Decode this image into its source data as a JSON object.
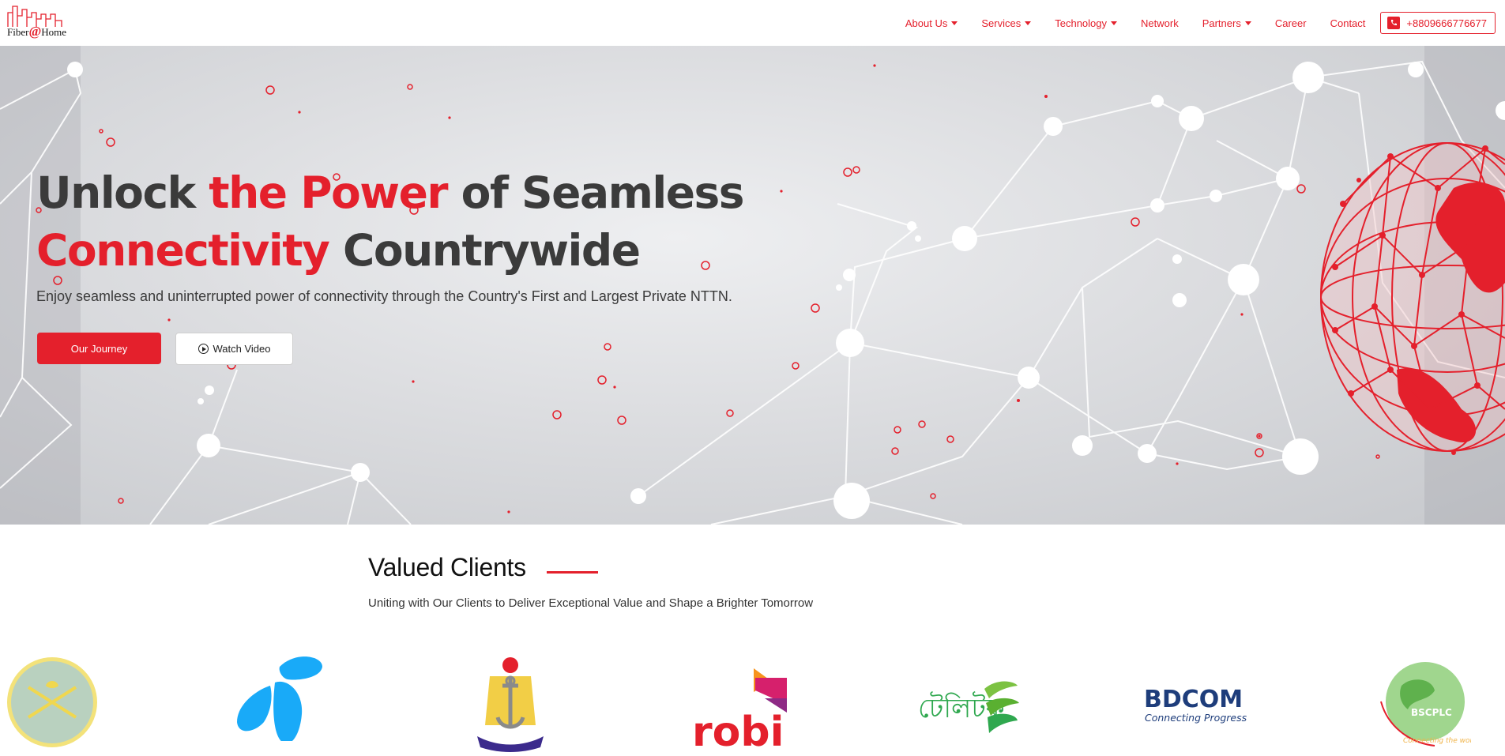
{
  "header": {
    "logo_text_1": "Fiber",
    "logo_at": "@",
    "logo_text_2": "Home",
    "nav": [
      {
        "label": "About Us",
        "dropdown": true
      },
      {
        "label": "Services",
        "dropdown": true
      },
      {
        "label": "Technology",
        "dropdown": true
      },
      {
        "label": "Network",
        "dropdown": false
      },
      {
        "label": "Partners",
        "dropdown": true
      },
      {
        "label": "Career",
        "dropdown": false
      },
      {
        "label": "Contact",
        "dropdown": false
      }
    ],
    "phone": "+8809666776677"
  },
  "hero": {
    "title_1": "Unlock ",
    "title_red_1": "the Power",
    "title_2": " of Seamless ",
    "title_red_2": "Connectivity",
    "title_3": " Countrywide",
    "subtitle": "Enjoy seamless and uninterrupted power of connectivity through the Country's First and Largest Private NTTN.",
    "primary_button": "Our Journey",
    "secondary_button": "Watch Video"
  },
  "clients": {
    "title": "Valued Clients",
    "subtitle": "Uniting with Our Clients to Deliver Exceptional Value and Shape a Brighter Tomorrow",
    "logos": [
      {
        "name": "bangladesh-army",
        "text": ""
      },
      {
        "name": "telenor",
        "text": ""
      },
      {
        "name": "bangladesh-navy",
        "text": ""
      },
      {
        "name": "robi",
        "text": "robi"
      },
      {
        "name": "teletalk",
        "text": "টেলিটক"
      },
      {
        "name": "bdcom",
        "text": "BDCOM",
        "tagline": "Connecting Progress"
      },
      {
        "name": "bscplc",
        "text": "BSCPLC",
        "tagline": "Connecting the world"
      }
    ]
  },
  "colors": {
    "accent": "#e4202c",
    "text": "#3b3b3b"
  }
}
